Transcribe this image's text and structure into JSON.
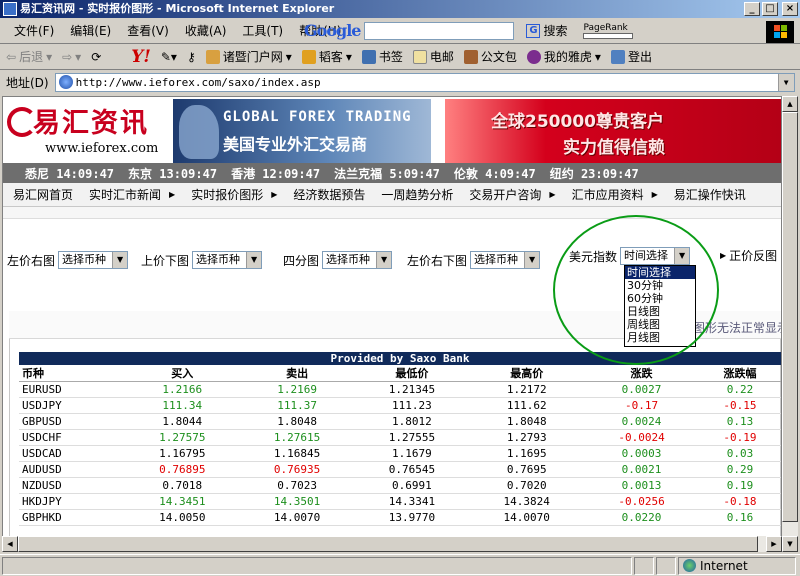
{
  "window": {
    "title": "易汇资讯网 - 实时报价图形 - Microsoft Internet Explorer"
  },
  "menu": [
    "文件(F)",
    "编辑(E)",
    "查看(V)",
    "收藏(A)",
    "工具(T)",
    "帮助(H)"
  ],
  "google": {
    "logo": "Google",
    "search": "搜索",
    "pagerank": "PageRank"
  },
  "toolbar": {
    "back": "后退",
    "yahoo": "Y!",
    "portal": "诸暨门户网",
    "blog": "韬客",
    "bookmark": "书签",
    "email": "电邮",
    "briefcase": "公文包",
    "myyahoo": "我的雅虎",
    "logout": "登出"
  },
  "address": {
    "label": "地址(D)",
    "url": "http://www.ieforex.com/saxo/index.asp"
  },
  "site": {
    "logo": "易汇资讯",
    "url": "www.ieforex.com",
    "banner1_title": "GLOBAL FOREX TRADING",
    "banner1_sub": "美国专业外汇交易商",
    "banner2_line1": "全球250000尊贵客户",
    "banner2_line2": "实力值得信赖"
  },
  "clocks": [
    "悉尼 14:09:47",
    "东京 13:09:47",
    "香港 12:09:47",
    "法兰克福 5:09:47",
    "伦敦 4:09:47",
    "纽约 23:09:47"
  ],
  "nav": [
    "易汇网首页",
    "实时汇市新闻",
    "实时报价图形",
    "经济数据预告",
    "一周趋势分析",
    "交易开户咨询",
    "汇市应用资料",
    "易汇操作快讯"
  ],
  "selectors": {
    "left_right": "左价右图",
    "top_bottom": "上价下图",
    "quad": "四分图",
    "left_bottom": "左价右下图",
    "usd_index": "美元指数",
    "reverse": "正价反图",
    "choose_currency": "选择币种",
    "choose_time": "时间选择"
  },
  "time_options": [
    "时间选择",
    "30分钟",
    "60分钟",
    "日线图",
    "周线图",
    "月线图"
  ],
  "warning": "图形无法正常显示",
  "table": {
    "caption": "Provided by Saxo Bank",
    "headers": [
      "币种",
      "买入",
      "卖出",
      "最低价",
      "最高价",
      "涨跌",
      "涨跌幅"
    ],
    "rows": [
      [
        "EURUSD",
        "1.2166",
        "1.2169",
        "1.21345",
        "1.2172",
        "0.0027",
        "0.22"
      ],
      [
        "USDJPY",
        "111.34",
        "111.37",
        "111.23",
        "111.62",
        "-0.17",
        "-0.15"
      ],
      [
        "GBPUSD",
        "1.8044",
        "1.8048",
        "1.8012",
        "1.8048",
        "0.0024",
        "0.13"
      ],
      [
        "USDCHF",
        "1.27575",
        "1.27615",
        "1.27555",
        "1.2793",
        "-0.0024",
        "-0.19"
      ],
      [
        "USDCAD",
        "1.16795",
        "1.16845",
        "1.1679",
        "1.1695",
        "0.0003",
        "0.03"
      ],
      [
        "AUDUSD",
        "0.76895",
        "0.76935",
        "0.76545",
        "0.7695",
        "0.0021",
        "0.29"
      ],
      [
        "NZDUSD",
        "0.7018",
        "0.7023",
        "0.6991",
        "0.7020",
        "0.0013",
        "0.19"
      ],
      [
        "HKDJPY",
        "14.3451",
        "14.3501",
        "14.3341",
        "14.3824",
        "-0.0256",
        "-0.18"
      ],
      [
        "GBPHKD",
        "14.0050",
        "14.0070",
        "13.9770",
        "14.0070",
        "0.0220",
        "0.16"
      ]
    ]
  },
  "status": {
    "zone": "Internet"
  },
  "colors": {
    "up": "#1d8f1d",
    "down": "#e00000",
    "title_bar": "#0a246a"
  }
}
